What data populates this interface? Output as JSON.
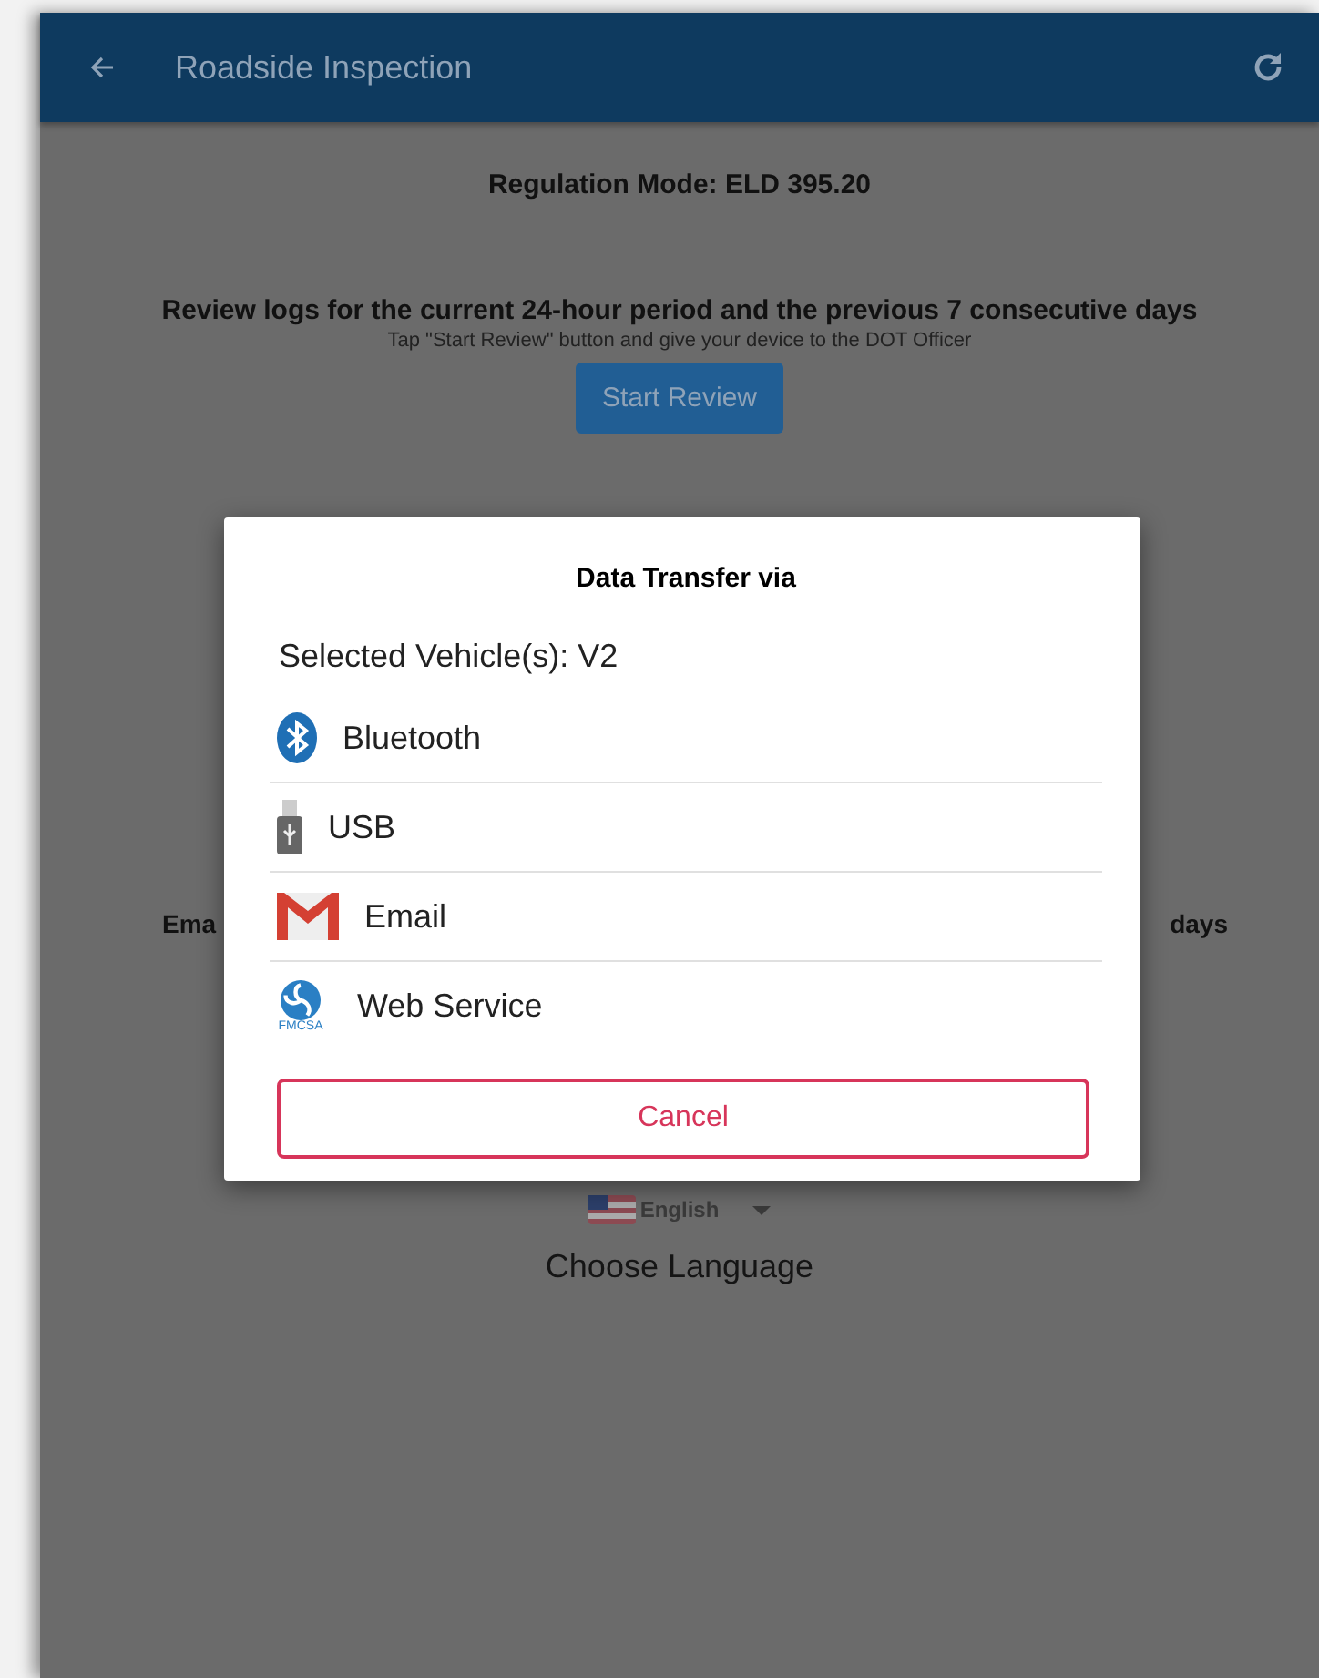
{
  "app_bar": {
    "title": "Roadside Inspection"
  },
  "regulation_mode": "Regulation Mode: ELD 395.20",
  "review": {
    "heading": "Review logs for the current 24-hour period and the previous 7 consecutive days",
    "hint": "Tap \"Start Review\" button and give your device to the DOT Officer",
    "button": "Start Review"
  },
  "email_section": {
    "heading_left": "Ema",
    "heading_right": "days"
  },
  "language": {
    "value": "English",
    "label": "Choose Language"
  },
  "dialog": {
    "title": "Data Transfer via",
    "subtitle": "Selected Vehicle(s): V2",
    "options": [
      {
        "kind": "bluetooth",
        "label": "Bluetooth"
      },
      {
        "kind": "usb",
        "label": "USB"
      },
      {
        "kind": "email",
        "label": "Email"
      },
      {
        "kind": "web",
        "label": "Web Service",
        "logo_text": "FMCSA"
      }
    ],
    "cancel": "Cancel"
  }
}
